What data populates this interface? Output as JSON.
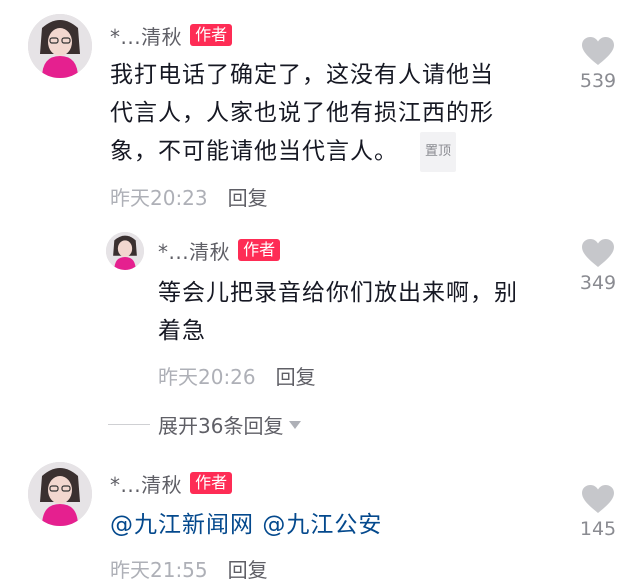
{
  "comments": [
    {
      "username": "*...清秋",
      "author_tag": "作者",
      "lines": [
        "我打电话了确定了，这没有人请他当",
        "代言人，人家也说了他有损江西的形",
        "象，不可能请他当代言人。"
      ],
      "pinned_label": "置顶",
      "time": "昨天20:23",
      "reply_label": "回复",
      "likes": "539"
    },
    {
      "username": "*...清秋",
      "author_tag": "作者",
      "lines": [
        "等会儿把录音给你们放出来啊，别",
        "着急"
      ],
      "time": "昨天20:26",
      "reply_label": "回复",
      "likes": "349"
    },
    {
      "username": "*...清秋",
      "author_tag": "作者",
      "mentions": [
        "@九江新闻网",
        "@九江公安"
      ],
      "time": "昨天21:55",
      "reply_label": "回复",
      "likes": "145"
    }
  ],
  "expand_replies_label": "展开36条回复",
  "icons": {
    "like": "heart-icon",
    "expand": "chevron-down-icon"
  },
  "colors": {
    "author_tag": "#fe2c55",
    "mention": "#04498d",
    "like_icon": "#c6c7cb"
  }
}
